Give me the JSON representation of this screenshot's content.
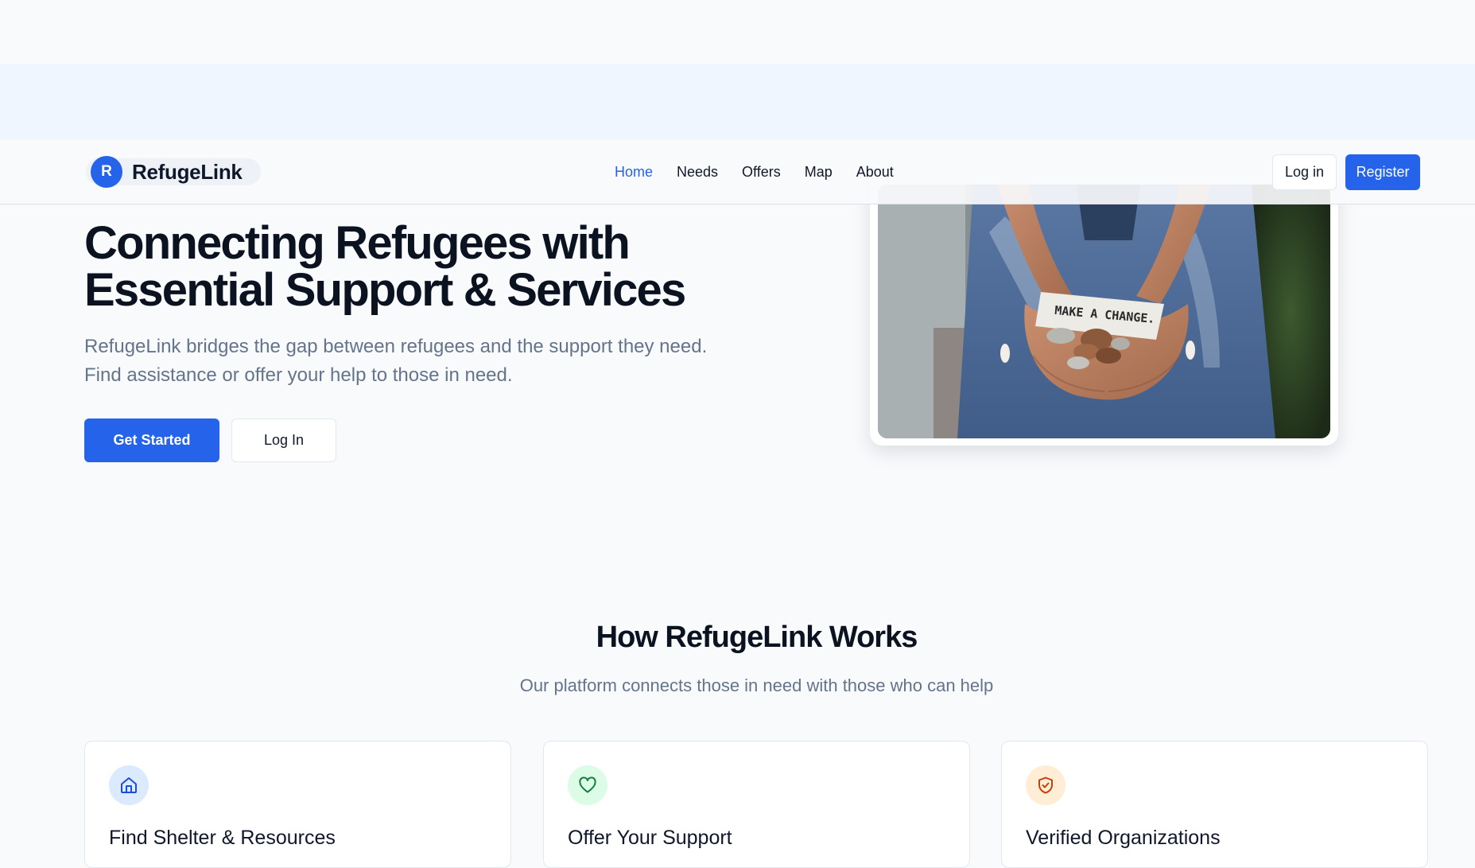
{
  "header": {
    "logo_letter": "R",
    "logo_name": "RefugeLink",
    "nav": [
      {
        "label": "Home",
        "active": true
      },
      {
        "label": "Needs",
        "active": false
      },
      {
        "label": "Offers",
        "active": false
      },
      {
        "label": "Map",
        "active": false
      },
      {
        "label": "About",
        "active": false
      }
    ],
    "login_label": "Log in",
    "register_label": "Register"
  },
  "hero": {
    "title_line1": "Connecting Refugees with",
    "title_line2": "Essential Support & Services",
    "subtitle_line1": "RefugeLink bridges the gap between refugees and the support they need.",
    "subtitle_line2": "Find assistance or offer your help to those in need.",
    "get_started_label": "Get Started",
    "login_label": "Log In",
    "photo_caption_text": "MAKE A CHANGE."
  },
  "how_it_works": {
    "title": "How RefugeLink Works",
    "subtitle": "Our platform connects those in need with those who can help",
    "cards": [
      {
        "title": "Find Shelter & Resources",
        "icon": "home-icon",
        "icon_bg": "#dbeafe",
        "icon_color": "#1d4ed8"
      },
      {
        "title": "Offer Your Support",
        "icon": "heart-icon",
        "icon_bg": "#dcfce7",
        "icon_color": "#15803d"
      },
      {
        "title": "Verified Organizations",
        "icon": "shield-check-icon",
        "icon_bg": "#ffedd5",
        "icon_color": "#c2410c"
      }
    ]
  },
  "colors": {
    "primary": "#2563eb",
    "background": "#f8fafc",
    "muted_text": "#64748b"
  }
}
